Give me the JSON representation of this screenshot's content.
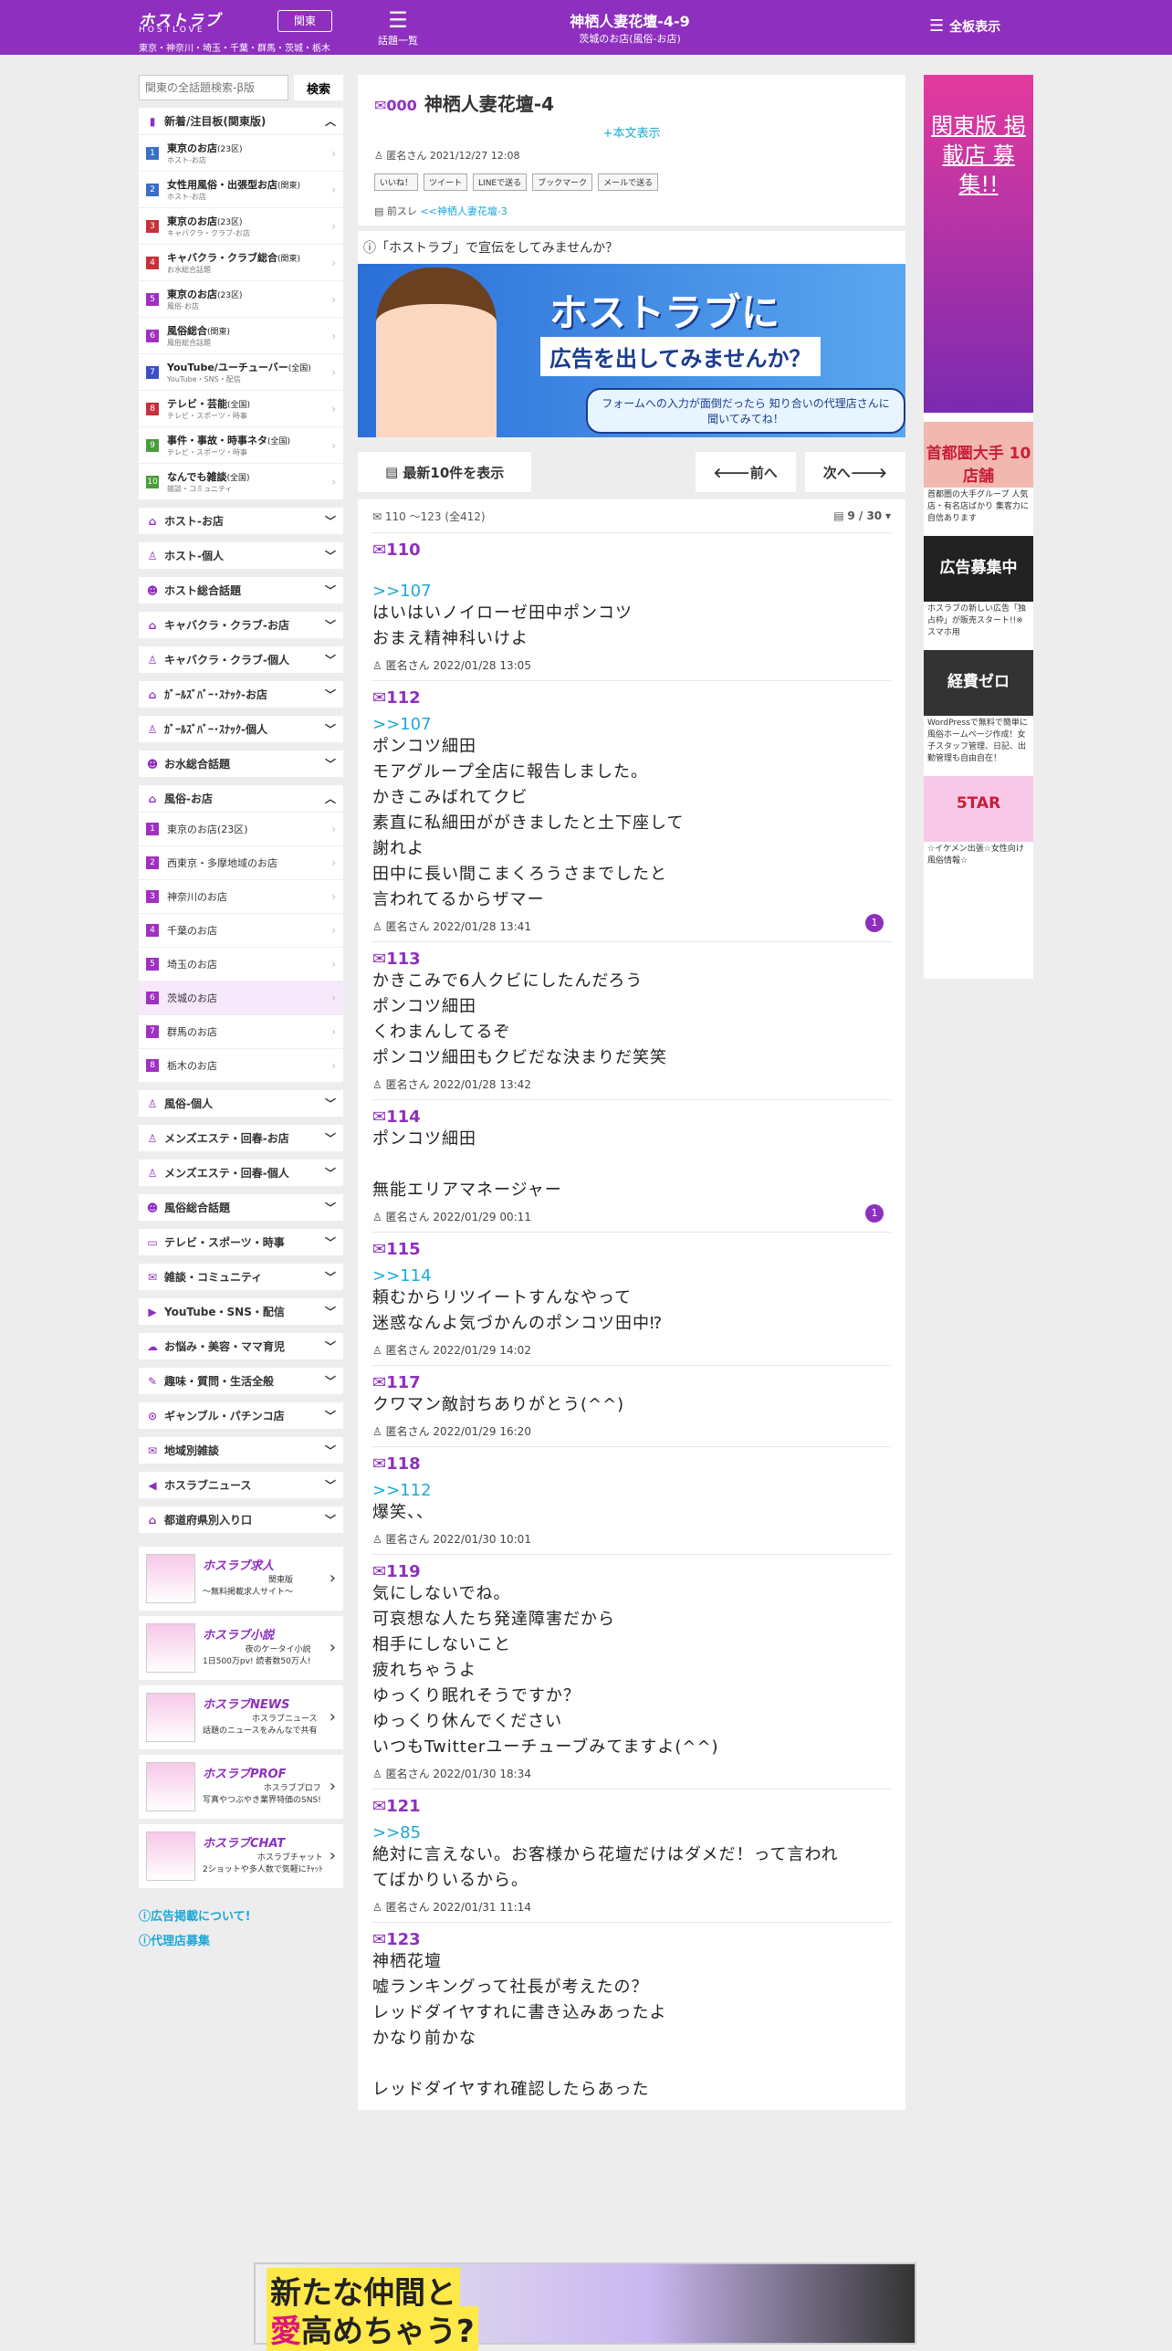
{
  "header": {
    "logo_jp": "ホストラブ",
    "logo_en": "HOSTLOVE",
    "logo_sub": "東京・神奈川・埼玉・千葉・群馬・茨城・栃木",
    "region": "関東",
    "topics_label": "話題一覧",
    "title": "神栖人妻花壇-4-9",
    "subtitle": "茨城のお店(風俗-お店)",
    "all_boards": "全板表示"
  },
  "search": {
    "placeholder": "関東の全話題検索-β版",
    "button": "検索"
  },
  "new_box": {
    "title": "新着/注目板(関東版)",
    "items": [
      {
        "no": "1",
        "title": "東京のお店",
        "tag": "(23区)",
        "sub": "ホスト-お店",
        "color": "#3a6fc8"
      },
      {
        "no": "2",
        "title": "女性用風俗・出張型お店",
        "tag": "(関東)",
        "sub": "ホスト-お店",
        "color": "#3a6fc8"
      },
      {
        "no": "3",
        "title": "東京のお店",
        "tag": "(23区)",
        "sub": "キャバクラ・クラブ-お店",
        "color": "#c8303a"
      },
      {
        "no": "4",
        "title": "キャバクラ・クラブ総合",
        "tag": "(関東)",
        "sub": "お水総合話題",
        "color": "#c8303a"
      },
      {
        "no": "5",
        "title": "東京のお店",
        "tag": "(23区)",
        "sub": "風俗-お店",
        "color": "#a030c0"
      },
      {
        "no": "6",
        "title": "風俗総合",
        "tag": "(関東)",
        "sub": "風俗総合話題",
        "color": "#a030c0"
      },
      {
        "no": "7",
        "title": "YouTube/ユーチューバー",
        "tag": "(全国)",
        "sub": "YouTube・SNS・配信",
        "color": "#3a4fc8"
      },
      {
        "no": "8",
        "title": "テレビ・芸能",
        "tag": "(全国)",
        "sub": "テレビ・スポーツ・時事",
        "color": "#c8303a"
      },
      {
        "no": "9",
        "title": "事件・事故・時事ネタ",
        "tag": "(全国)",
        "sub": "テレビ・スポーツ・時事",
        "color": "#4a9c3a"
      },
      {
        "no": "10",
        "title": "なんでも雑談",
        "tag": "(全国)",
        "sub": "雑談・コミュニティ",
        "color": "#4a9c3a"
      }
    ]
  },
  "categories_a": [
    {
      "label": "ホスト-お店",
      "icon": "⌂"
    },
    {
      "label": "ホスト-個人",
      "icon": "♙"
    },
    {
      "label": "ホスト総合話題",
      "icon": "☻"
    },
    {
      "label": "キャバクラ・クラブ-お店",
      "icon": "⌂"
    },
    {
      "label": "キャバクラ・クラブ-個人",
      "icon": "♙"
    },
    {
      "label": "ｶﾞｰﾙｽﾞﾊﾞｰ･ｽﾅｯｸ-お店",
      "icon": "⌂"
    },
    {
      "label": "ｶﾞｰﾙｽﾞﾊﾞｰ･ｽﾅｯｸ-個人",
      "icon": "♙"
    },
    {
      "label": "お水総合話題",
      "icon": "☻"
    }
  ],
  "fuzoku_box": {
    "title": "風俗-お店",
    "items": [
      "東京のお店(23区)",
      "西東京・多摩地域のお店",
      "神奈川のお店",
      "千葉のお店",
      "埼玉のお店",
      "茨城のお店",
      "群馬のお店",
      "栃木のお店"
    ]
  },
  "categories_b": [
    {
      "label": "風俗-個人",
      "icon": "♙"
    },
    {
      "label": "メンズエステ・回春-お店",
      "icon": "♙"
    },
    {
      "label": "メンズエステ・回春-個人",
      "icon": "♙"
    },
    {
      "label": "風俗総合話題",
      "icon": "☻"
    },
    {
      "label": "テレビ・スポーツ・時事",
      "icon": "▭"
    },
    {
      "label": "雑談・コミュニティ",
      "icon": "✉"
    },
    {
      "label": "YouTube・SNS・配信",
      "icon": "▶"
    },
    {
      "label": "お悩み・美容・ママ育児",
      "icon": "☁"
    },
    {
      "label": "趣味・質問・生活全般",
      "icon": "✎"
    },
    {
      "label": "ギャンブル・パチンコ店",
      "icon": "⊙"
    },
    {
      "label": "地域別雑談",
      "icon": "✉"
    },
    {
      "label": "ホスラブニュース",
      "icon": "◀"
    },
    {
      "label": "都道府県別入り口",
      "icon": "⌂"
    }
  ],
  "side_banners": [
    {
      "big": "ホスラブ求人",
      "line1": "関東版",
      "line2": "〜無料掲載求人サイト〜"
    },
    {
      "big": "ホスラブ小説",
      "line1": "夜のケータイ小説",
      "line2": "1日500万pv! 読者数50万人!"
    },
    {
      "big": "ホスラブNEWS",
      "line1": "ホスラブニュース",
      "line2": "話題のニュースをみんなで共有"
    },
    {
      "big": "ホスラブPROF",
      "line1": "ホスラブプロフ",
      "line2": "写真やつぶやき業界特価のSNS!"
    },
    {
      "big": "ホスラブCHAT",
      "line1": "ホスラブチャット",
      "line2": "2ショットや多人数で気軽にﾁｬｯﾄ"
    }
  ],
  "footer_links": [
    "広告掲載について!",
    "代理店募集"
  ],
  "thread": {
    "no": "000",
    "title": "神栖人妻花壇-4",
    "show_body": "+本文表示",
    "meta": "匿名さん 2021/12/27 12:08",
    "share": [
      "いいね！",
      "ツイート",
      "LINEで送る",
      "ブックマーク",
      "メールで送る"
    ],
    "prev_label": "前スレ",
    "prev_link": "<<神栖人妻花壇-3"
  },
  "ad_intro": "「ホストラブ」で宣伝をしてみませんか？",
  "ad_banner": {
    "l1": "ホストラブに",
    "l2": "広告を出してみませんか？",
    "l3": "フォームへの入力が面倒だったら 知り合いの代理店さんに聞いてみてね！"
  },
  "pager": {
    "latest": "最新10件を表示",
    "prev": "前へ",
    "next": "次へ"
  },
  "posts_head": {
    "range": "110 〜123 (全412)",
    "page": "9 / 30"
  },
  "posts": [
    {
      "no": "110",
      "anchor": "",
      "lines": [],
      "meta": "",
      "count": ""
    },
    {
      "no": "",
      "anchor": ">>107",
      "lines": [
        "はいはいノイローゼ田中ポンコツ",
        "おまえ精神科いけよ"
      ],
      "meta": "匿名さん 2022/01/28 13:05",
      "count": ""
    },
    {
      "no": "112",
      "anchor": ">>107",
      "lines": [
        "ポンコツ細田",
        "モアグループ全店に報告しました。",
        "かきこみばれてクビ",
        "素直に私細田ががきましたと土下座して",
        "謝れよ",
        "田中に長い間こまくろうさまでしたと",
        "言われてるからザマー"
      ],
      "meta": "匿名さん 2022/01/28 13:41",
      "count": "1"
    },
    {
      "no": "113",
      "anchor": "",
      "lines": [
        "かきこみで6人クビにしたんだろう",
        "ポンコツ細田",
        "くわまんしてるぞ",
        "ポンコツ細田もクビだな決まりだ笑笑"
      ],
      "meta": "匿名さん 2022/01/28 13:42",
      "count": ""
    },
    {
      "no": "114",
      "anchor": "",
      "lines": [
        "ポンコツ細田",
        "",
        "無能エリアマネージャー"
      ],
      "meta": "匿名さん 2022/01/29 00:11",
      "count": "1"
    },
    {
      "no": "115",
      "anchor": ">>114",
      "lines": [
        "頼むからリツイートすんなやって",
        "迷惑なんよ気づかんのポンコツ田中⁉"
      ],
      "meta": "匿名さん 2022/01/29 14:02",
      "count": ""
    },
    {
      "no": "117",
      "anchor": "",
      "lines": [
        "クワマン敵討ちありがとう(^^)"
      ],
      "meta": "匿名さん 2022/01/29 16:20",
      "count": ""
    },
    {
      "no": "118",
      "anchor": ">>112",
      "lines": [
        "爆笑、、"
      ],
      "meta": "匿名さん 2022/01/30 10:01",
      "count": ""
    },
    {
      "no": "119",
      "anchor": "",
      "lines": [
        "気にしないでね。",
        "可哀想な人たち発達障害だから",
        "相手にしないこと",
        "疲れちゃうよ",
        "ゆっくり眠れそうですか？",
        "ゆっくり休んでください",
        "いつもTwitterユーチューブみてますよ(^^)"
      ],
      "meta": "匿名さん 2022/01/30 18:34",
      "count": ""
    },
    {
      "no": "121",
      "anchor": ">>85",
      "lines": [
        "絶対に言えない。お客様から花壇だけはダメだ！って言われ",
        "てばかりいるから。"
      ],
      "meta": "匿名さん 2022/01/31 11:14",
      "count": ""
    },
    {
      "no": "123",
      "anchor": "",
      "lines": [
        "神栖花壇",
        "嘘ランキングって社長が考えたの？",
        "レッドダイヤすれに書き込みあったよ",
        "かなり前かな",
        "",
        "レッドダイヤすれ確認したらあった"
      ],
      "meta": "",
      "count": ""
    }
  ],
  "right_ads": [
    {
      "title": "関東版 掲載店 募集!!",
      "caption": ""
    },
    {
      "title": "首都圏大手 10店舗",
      "caption": "首都圏の大手グループ 人気店・有名店ばかり 集客力に自信あります"
    },
    {
      "title": "広告募集中",
      "caption": "ホスラブの新しい広告「独占枠」が販売スタート!!※スマホ用"
    },
    {
      "title": "経費ゼロ",
      "caption": "WordPressで無料で簡単に風俗ホームページ作成！女子スタッフ管理、日記、出勤管理も自由自在！"
    },
    {
      "title": "5TAR",
      "caption": "☆イケメン出張☆女性向け風俗情報☆"
    }
  ],
  "bottom_ad": {
    "l1": "新たな仲間と",
    "l2a": "愛",
    "l2b": "高めちゃう?"
  }
}
